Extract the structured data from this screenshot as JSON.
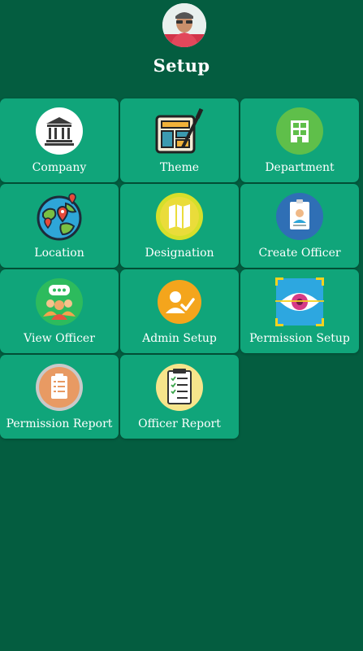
{
  "header": {
    "title": "Setup",
    "avatar": "user-avatar"
  },
  "tiles": [
    {
      "label": "Company",
      "icon": "bank-icon"
    },
    {
      "label": "Theme",
      "icon": "palette-icon"
    },
    {
      "label": "Department",
      "icon": "building-icon"
    },
    {
      "label": "Location",
      "icon": "globe-pin-icon"
    },
    {
      "label": "Designation",
      "icon": "map-icon"
    },
    {
      "label": "Create Officer",
      "icon": "id-badge-icon"
    },
    {
      "label": "View Officer",
      "icon": "users-chat-icon"
    },
    {
      "label": "Admin Setup",
      "icon": "user-check-icon"
    },
    {
      "label": "Permission Setup",
      "icon": "eye-scan-icon"
    },
    {
      "label": "Permission Report",
      "icon": "clipboard-icon"
    },
    {
      "label": "Officer Report",
      "icon": "checklist-icon"
    }
  ],
  "colors": {
    "background": "#045d40",
    "tile": "#10a57a"
  }
}
